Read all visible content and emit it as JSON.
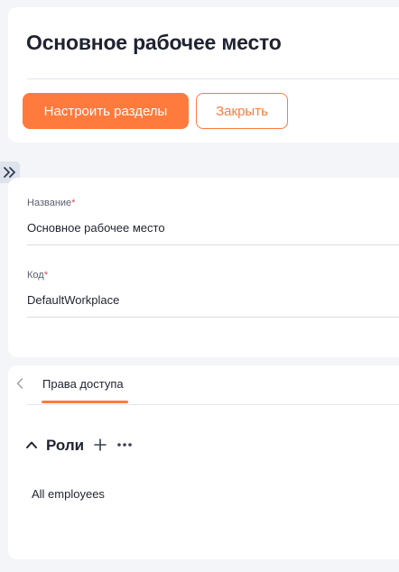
{
  "header": {
    "title": "Основное рабочее место",
    "configure_button": "Настроить разделы",
    "close_button": "Закрыть"
  },
  "fields": {
    "name": {
      "label": "Название",
      "required_mark": "*",
      "value": "Основное рабочее место"
    },
    "code": {
      "label": "Код",
      "required_mark": "*",
      "value": "DefaultWorkplace"
    }
  },
  "tabs": {
    "items": [
      {
        "label": "Права доступа",
        "active": true
      }
    ]
  },
  "roles_section": {
    "title": "Роли",
    "items": [
      "All employees"
    ]
  },
  "icons": {
    "sidebar_toggle": "double-chevron-right-icon",
    "tabs_back": "chevron-left-icon",
    "collapse": "chevron-up-icon",
    "add": "plus-icon",
    "more": "more-horizontal-icon"
  },
  "colors": {
    "accent": "#ff7a3d",
    "required": "#e5484d",
    "background": "#f4f5f8",
    "card": "#ffffff"
  }
}
